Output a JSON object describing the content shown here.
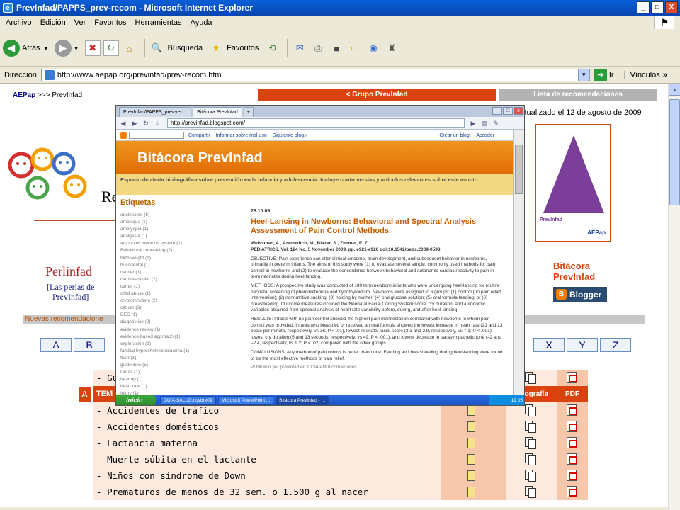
{
  "window": {
    "title": "PrevInfad/PAPPS_prev-recom - Microsoft Internet Explorer",
    "buttons": [
      "_",
      "□",
      "X"
    ]
  },
  "menu": [
    "Archivo",
    "Edición",
    "Ver",
    "Favoritos",
    "Herramientas",
    "Ayuda"
  ],
  "toolbar": {
    "back_label": "Atrás",
    "search_label": "Búsqueda",
    "favorites_label": "Favoritos"
  },
  "address": {
    "label": "Dirección",
    "url": "http://www.aepap.org/previnfad/prev-recom.htm",
    "go_label": "Ir",
    "links_label": "Vínculos"
  },
  "page": {
    "breadcrumb_site": "AEPap",
    "breadcrumb_rest": ">>> PrevInfad",
    "nav_grupo": "< Grupo PrevInfad",
    "nav_lista": "Lista de recomendaciones",
    "updated": "ctualizado el 12 de agosto de 2009",
    "partial_title": "Re",
    "perlinfad_title": "Perlinfad",
    "perlinfad_sub_1": "[Las perlas de",
    "perlinfad_sub_2": "PrevInfad]",
    "nuevas_bar": "Nuevas recomendacione",
    "bitacora_1": "Bitácora",
    "bitacora_2": "PrevInfad",
    "blogger_badge": "Blogger",
    "book_publisher": "PrevInfad",
    "book_logo": "AEPap",
    "letters_left": [
      "A",
      "B"
    ],
    "letters_right": [
      "X",
      "Y",
      "Z"
    ],
    "first_topic_partial": "Gu",
    "tema_letter": "A",
    "tema_header": "TEM",
    "bibliografia_header": "ibliografía",
    "pdf_header": "PDF",
    "topics": [
      "Accidentes de tráfico",
      "Accidentes domésticos",
      "Lactancia materna",
      "Muerte súbita en el lactante",
      "Niños con síndrome de Down",
      "Prematuros de menos de 32 sem. o 1.500 g al nacer"
    ]
  },
  "embedded_browser": {
    "tabs": [
      "PrevInfad/PAPPS_prev-rec...",
      "Bitácora PrevInfad"
    ],
    "url": "http://previnfad.blogspot.com/",
    "blogger_nav": [
      "Compartir",
      "Informar sobre mal uso",
      "Siguiente blog»"
    ],
    "blogger_nav_right": [
      "Crear un blog",
      "Acceder"
    ],
    "blog_title": "Bitácora PrevInfad",
    "blog_description": "Espacio de alerta bibliográfica sobre prevención en la infancia y adolescencia. Incluye controversias y artículos relevantes sobre este asunto.",
    "labels_heading": "Etiquetas",
    "labels": [
      "adolescent (6)",
      "ambliopía (1)",
      "amblyopia (1)",
      "analgesia (1)",
      "autonomic nervous system (1)",
      "Behavioral counseling (2)",
      "birth weight (1)",
      "bucodental (1)",
      "cancer (1)",
      "cardiovascular (2)",
      "caries (1)",
      "child abuse (1)",
      "cryptorchidism (2)",
      "cáncer (3)",
      "DEC (1)",
      "diagnóstico (2)",
      "evidence review (1)",
      "evidence-based approach (1)",
      "exploración (1)",
      "familial hypercholesterolaemia (1)",
      "fluor (1)",
      "guidelines (5)",
      "Guías (1)",
      "hearing (1)",
      "heart rate (1)",
      "Injury (1)"
    ],
    "post_date": "28.10.09",
    "post_title": "Heel-Lancing in Newborns: Behavioral and Spectral Analysis Assessment of Pain Control Methods.",
    "post_authors": "Weissman, A., Aranovitch, M., Blazer, S., Zimmer, E. Z.",
    "post_citation": "PEDIATRICS. Vol. 124 No. 5 November 2009, pp. e921-e926 doi:10.1542/peds.2009-0598",
    "objective": "OBJECTIVE: Pain experience can alter clinical outcome, brain development, and subsequent behavior in newborns, primarily in preterm infants. The aims of this study were (1) to evaluate several simple, commonly used methods for pain control in newborns and (2) to evaluate the concordance between behavioral and autonomic cardiac reactivity to pain in term neonates during heel-lancing.",
    "methods": "METHODS: A prospective study was conducted of 180 term newborn infants who were undergoing heel-lancing for routine neonatal screening of phenylketonuria and hypothyroidism. Newborns were assigned to 6 groups: (1) control (no pain relief intervention); (2) nonnutritive sucking; (3) holding by mother; (4) oral glucose solution; (5) oral formula feeding; or (6) breastfeeding. Outcome measures included the Neonatal Facial Coding System score; cry duration; and autonomic variables obtained from spectral analysis of heart rate variability before, during, and after heel-lancing.",
    "results": "RESULTS: Infants with no pain control showed the highest pain manifestation compared with newborns to whom pain control was provided. Infants who breastfed or received an oral formula showed the lowest increase in heart rate (21 and 23 beats per minute, respectively, vs 36; P < .01), lowest neonatal facial score (2.3 and 2.9, respectively, vs 7.1; P < .001), lowest cry duration (5 and 13 seconds, respectively, vs 49; P < .001), and lowest decrease in parasympathetic tone (–2 and –2.4, respectively, vs 1.2; P < .02) compared with the other groups.",
    "conclusions": "CONCLUSIONS: Any method of pain control is better than none. Feeding and breastfeeding during heel-lancing were found to be the most effective methods of pain relief.",
    "post_footer": "Publicado por previnfad en 10:34 PM 0 comentarios",
    "taskbar_start": "Inicio",
    "taskbar_items": [
      "GUÍA-SALUD.novbre09",
      "Microsoft PowerPoint ...",
      "Bitácora PrevInfad - ..."
    ],
    "clock": "19:05"
  }
}
